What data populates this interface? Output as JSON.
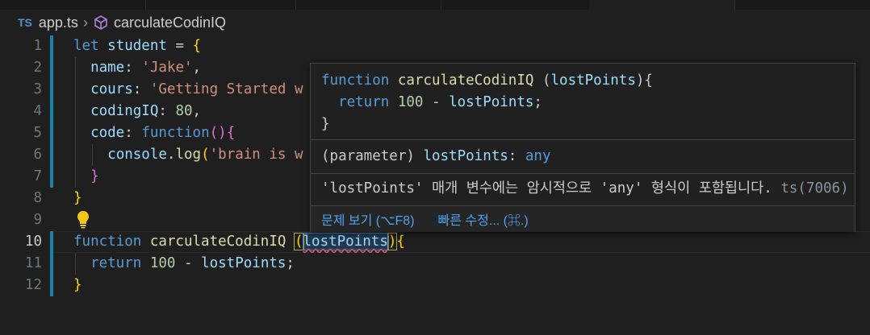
{
  "breadcrumb": {
    "lang_badge": "TS",
    "file": "app.ts",
    "symbol": "carculateCodinIQ",
    "colors": {
      "badge": "#4e94ce",
      "symbol_icon": "#b180d7"
    }
  },
  "editor": {
    "lines": [
      {
        "num": "1",
        "tokens": [
          [
            "k",
            "let "
          ],
          [
            "v",
            "student"
          ],
          [
            "p",
            " = "
          ],
          [
            "br1",
            "{"
          ]
        ]
      },
      {
        "num": "2",
        "tokens": [
          [
            "p",
            "  "
          ],
          [
            "v",
            "name"
          ],
          [
            "p",
            ": "
          ],
          [
            "s",
            "'Jake'"
          ],
          [
            "p",
            ","
          ]
        ]
      },
      {
        "num": "3",
        "tokens": [
          [
            "p",
            "  "
          ],
          [
            "v",
            "cours"
          ],
          [
            "p",
            ": "
          ],
          [
            "s",
            "'Getting Started w"
          ]
        ]
      },
      {
        "num": "4",
        "tokens": [
          [
            "p",
            "  "
          ],
          [
            "v",
            "codingIQ"
          ],
          [
            "p",
            ": "
          ],
          [
            "n",
            "80"
          ],
          [
            "p",
            ","
          ]
        ]
      },
      {
        "num": "5",
        "tokens": [
          [
            "p",
            "  "
          ],
          [
            "v",
            "code"
          ],
          [
            "p",
            ": "
          ],
          [
            "k",
            "function"
          ],
          [
            "br2",
            "()"
          ],
          [
            "br2",
            "{"
          ]
        ]
      },
      {
        "num": "6",
        "tokens": [
          [
            "p",
            "    "
          ],
          [
            "v",
            "console"
          ],
          [
            "p",
            "."
          ],
          [
            "f",
            "log"
          ],
          [
            "br1",
            "("
          ],
          [
            "s",
            "'brain is w"
          ]
        ]
      },
      {
        "num": "7",
        "tokens": [
          [
            "p",
            "  "
          ],
          [
            "br2",
            "}"
          ]
        ]
      },
      {
        "num": "8",
        "tokens": [
          [
            "br1",
            "}"
          ]
        ]
      },
      {
        "num": "9",
        "tokens": []
      },
      {
        "num": "10",
        "tokens": [
          [
            "k",
            "function "
          ],
          [
            "f",
            "carculateCodinIQ "
          ],
          [
            "br1",
            "("
          ],
          [
            "v",
            "lostPoints"
          ],
          [
            "br1",
            ")"
          ],
          [
            "br1",
            "{"
          ]
        ]
      },
      {
        "num": "11",
        "tokens": [
          [
            "p",
            "  "
          ],
          [
            "k",
            "return "
          ],
          [
            "n",
            "100"
          ],
          [
            "p",
            " - "
          ],
          [
            "v",
            "lostPoints"
          ],
          [
            "p",
            ";"
          ]
        ]
      },
      {
        "num": "12",
        "tokens": [
          [
            "br1",
            "}"
          ]
        ]
      }
    ],
    "active_line": "10"
  },
  "hover": {
    "signature": [
      [
        [
          "k",
          "function "
        ],
        [
          "f",
          "carculateCodinIQ "
        ],
        [
          "p",
          "("
        ],
        [
          "v",
          "lostPoints"
        ],
        [
          "p",
          "){"
        ]
      ],
      [
        [
          "p",
          "  "
        ],
        [
          "k",
          "return "
        ],
        [
          "n",
          "100"
        ],
        [
          "p",
          " - "
        ],
        [
          "v",
          "lostPoints"
        ],
        [
          "p",
          ";"
        ]
      ],
      [
        [
          "p",
          "}"
        ]
      ]
    ],
    "param_label": "(parameter) ",
    "param_name": "lostPoints",
    "param_sep": ": ",
    "param_type": "any",
    "diagnostic": "'lostPoints' 매개 변수에는 암시적으로 'any' 형식이 포함됩니다.",
    "diagnostic_code": "ts(7006)",
    "view_problem": "문제 보기 (⌥F8)",
    "quick_fix": "빠른 수정... (⌘.)"
  }
}
